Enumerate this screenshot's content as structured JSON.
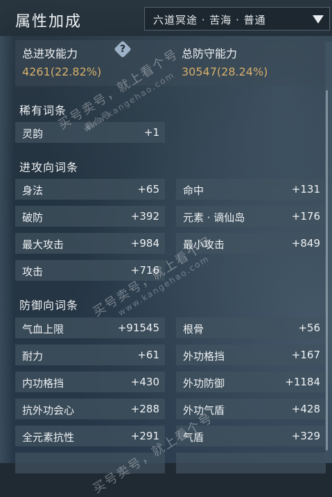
{
  "header": {
    "title": "属性加成",
    "dropdown_value": "六道冥途 · 苦海 · 普通"
  },
  "summary": {
    "attack_label": "总进攻能力",
    "attack_value": "4261(22.82%)",
    "defense_label": "总防守能力",
    "defense_value": "30547(28.24%)"
  },
  "sections": {
    "rare": "稀有词条",
    "attack": "进攻向词条",
    "defense": "防御向词条"
  },
  "rare_stats": [
    {
      "label": "灵韵",
      "value": "+1"
    }
  ],
  "attack_stats": [
    {
      "label": "身法",
      "value": "+65"
    },
    {
      "label": "命中",
      "value": "+131"
    },
    {
      "label": "破防",
      "value": "+392"
    },
    {
      "label": "元素 · 谪仙岛",
      "value": "+176"
    },
    {
      "label": "最大攻击",
      "value": "+984"
    },
    {
      "label": "最小攻击",
      "value": "+849"
    },
    {
      "label": "攻击",
      "value": "+716"
    }
  ],
  "defense_stats": [
    {
      "label": "气血上限",
      "value": "+91545"
    },
    {
      "label": "根骨",
      "value": "+56"
    },
    {
      "label": "耐力",
      "value": "+61"
    },
    {
      "label": "外功格挡",
      "value": "+167"
    },
    {
      "label": "内功格挡",
      "value": "+430"
    },
    {
      "label": "外功防御",
      "value": "+1184"
    },
    {
      "label": "抗外功会心",
      "value": "+288"
    },
    {
      "label": "外功气盾",
      "value": "+428"
    },
    {
      "label": "全元素抗性",
      "value": "+291"
    },
    {
      "label": "气盾",
      "value": "+329"
    }
  ],
  "watermark": {
    "text": "买号卖号，就上看个号",
    "url": "www.kangehao.com",
    "badge": "看个号"
  },
  "colors": {
    "accent_gold": "#d6b06a",
    "card_bg": "#425260",
    "text": "#eef2f4"
  }
}
